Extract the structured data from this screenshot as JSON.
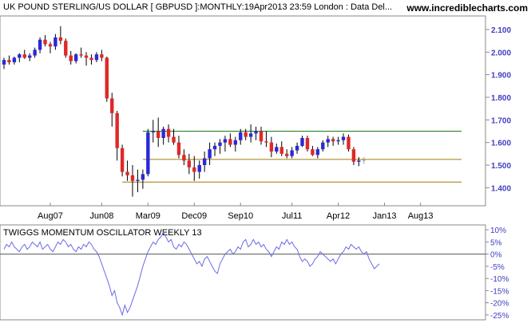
{
  "header": {
    "title": "UK POUND STERLING/US DOLLAR [ GBPUSD ]:MONTHLY:19Apr2013 23:59 London : Data Del...",
    "site": "www.incrediblecharts.com"
  },
  "colors": {
    "up": "#2a2ad6",
    "down": "#e02828",
    "last": "#9a9a9a",
    "resistance": "#1a7a1a",
    "support_line": "#a07a00",
    "oscillator": "#6a6ae8",
    "axis_text": "#4040c0",
    "frame": "#888888"
  },
  "chart_data": [
    {
      "type": "candlestick",
      "title": "UK POUND STERLING/US DOLLAR [ GBPUSD ]:MONTHLY:19Apr2013 23:59 London : Data Del...",
      "x_tick_labels": [
        "Aug07",
        "Jun08",
        "Mar09",
        "Dec09",
        "Sep10",
        "Jul11",
        "Apr12",
        "Jan13",
        "Aug13"
      ],
      "y_tick_labels": [
        "2.100",
        "2.000",
        "1.900",
        "1.800",
        "1.700",
        "1.600",
        "1.500",
        "1.400"
      ],
      "ylim": [
        1.32,
        2.16
      ],
      "start_month": "2006-11",
      "candles": [
        [
          1.945,
          1.975,
          1.925,
          1.965
        ],
        [
          1.965,
          1.985,
          1.945,
          1.955
        ],
        [
          1.955,
          1.98,
          1.945,
          1.975
        ],
        [
          1.975,
          1.995,
          1.955,
          1.99
        ],
        [
          1.99,
          2.01,
          1.97,
          1.975
        ],
        [
          1.975,
          1.995,
          1.96,
          1.985
        ],
        [
          1.985,
          2.02,
          1.975,
          2.01
        ],
        [
          2.01,
          2.065,
          1.995,
          2.055
        ],
        [
          2.055,
          2.075,
          2.025,
          2.035
        ],
        [
          2.035,
          2.045,
          1.995,
          2.025
        ],
        [
          2.025,
          2.08,
          2.01,
          2.065
        ],
        [
          2.065,
          2.115,
          2.035,
          2.05
        ],
        [
          2.05,
          2.06,
          1.975,
          1.985
        ],
        [
          1.985,
          2.005,
          1.945,
          1.96
        ],
        [
          1.96,
          1.995,
          1.95,
          1.99
        ],
        [
          1.99,
          2.02,
          1.975,
          1.985
        ],
        [
          1.985,
          2.0,
          1.94,
          1.975
        ],
        [
          1.975,
          1.99,
          1.945,
          1.965
        ],
        [
          1.965,
          2.0,
          1.955,
          1.99
        ],
        [
          1.99,
          2.01,
          1.96,
          1.975
        ],
        [
          1.975,
          1.98,
          1.78,
          1.795
        ],
        [
          1.795,
          1.82,
          1.67,
          1.73
        ],
        [
          1.73,
          1.74,
          1.52,
          1.575
        ],
        [
          1.575,
          1.59,
          1.45,
          1.47
        ],
        [
          1.47,
          1.52,
          1.43,
          1.455
        ],
        [
          1.455,
          1.5,
          1.36,
          1.43
        ],
        [
          1.43,
          1.48,
          1.38,
          1.435
        ],
        [
          1.435,
          1.48,
          1.395,
          1.46
        ],
        [
          1.46,
          1.66,
          1.45,
          1.645
        ],
        [
          1.645,
          1.7,
          1.6,
          1.65
        ],
        [
          1.65,
          1.71,
          1.58,
          1.62
        ],
        [
          1.62,
          1.67,
          1.59,
          1.66
        ],
        [
          1.66,
          1.68,
          1.6,
          1.625
        ],
        [
          1.625,
          1.66,
          1.59,
          1.6
        ],
        [
          1.6,
          1.63,
          1.53,
          1.545
        ],
        [
          1.545,
          1.57,
          1.5,
          1.52
        ],
        [
          1.52,
          1.55,
          1.46,
          1.49
        ],
        [
          1.49,
          1.54,
          1.43,
          1.47
        ],
        [
          1.47,
          1.52,
          1.44,
          1.5
        ],
        [
          1.5,
          1.56,
          1.47,
          1.53
        ],
        [
          1.53,
          1.6,
          1.5,
          1.57
        ],
        [
          1.57,
          1.6,
          1.54,
          1.585
        ],
        [
          1.585,
          1.615,
          1.55,
          1.6
        ],
        [
          1.6,
          1.63,
          1.56,
          1.615
        ],
        [
          1.615,
          1.64,
          1.58,
          1.59
        ],
        [
          1.59,
          1.625,
          1.56,
          1.61
        ],
        [
          1.61,
          1.66,
          1.59,
          1.645
        ],
        [
          1.645,
          1.66,
          1.61,
          1.625
        ],
        [
          1.625,
          1.68,
          1.6,
          1.64
        ],
        [
          1.64,
          1.67,
          1.61,
          1.65
        ],
        [
          1.65,
          1.67,
          1.59,
          1.605
        ],
        [
          1.605,
          1.65,
          1.58,
          1.6
        ],
        [
          1.6,
          1.625,
          1.535,
          1.56
        ],
        [
          1.56,
          1.595,
          1.55,
          1.58
        ],
        [
          1.58,
          1.605,
          1.54,
          1.55
        ],
        [
          1.55,
          1.57,
          1.53,
          1.54
        ],
        [
          1.54,
          1.58,
          1.53,
          1.565
        ],
        [
          1.565,
          1.6,
          1.55,
          1.585
        ],
        [
          1.585,
          1.63,
          1.58,
          1.62
        ],
        [
          1.62,
          1.63,
          1.56,
          1.57
        ],
        [
          1.57,
          1.585,
          1.54,
          1.545
        ],
        [
          1.545,
          1.58,
          1.53,
          1.57
        ],
        [
          1.57,
          1.61,
          1.56,
          1.6
        ],
        [
          1.6,
          1.63,
          1.58,
          1.615
        ],
        [
          1.615,
          1.625,
          1.585,
          1.605
        ],
        [
          1.605,
          1.625,
          1.59,
          1.61
        ],
        [
          1.61,
          1.64,
          1.59,
          1.625
        ],
        [
          1.625,
          1.635,
          1.56,
          1.57
        ],
        [
          1.57,
          1.58,
          1.5,
          1.515
        ],
        [
          1.515,
          1.535,
          1.495,
          1.52
        ],
        [
          1.52,
          1.535,
          1.505,
          1.525
        ]
      ],
      "horizontal_lines": [
        {
          "name": "resistance",
          "value": 1.65,
          "from_month_index": 27
        },
        {
          "name": "support",
          "value": 1.525,
          "from_month_index": 27
        },
        {
          "name": "low",
          "value": 1.425,
          "from_month_index": 23
        }
      ]
    },
    {
      "type": "line",
      "title": "TWIGGS MOMENTUM OSCILLATOR WEEKLY 13",
      "y_tick_labels": [
        "10%",
        "5%",
        "0%",
        "-5%",
        "-10%",
        "-15%",
        "-20%",
        "-25%"
      ],
      "ylim": [
        -27,
        12
      ],
      "zero_line": 0,
      "start_month": "2006-11",
      "points_per_month": 2,
      "values": [
        2,
        4,
        3,
        5,
        3,
        2,
        1,
        3,
        4,
        2,
        3,
        5,
        4,
        3,
        5,
        2,
        3,
        4,
        2,
        1,
        3,
        5,
        4,
        6,
        5,
        3,
        4,
        2,
        1,
        3,
        2,
        4,
        3,
        5,
        4,
        2,
        1,
        -1,
        -4,
        -7,
        -10,
        -13,
        -17,
        -15,
        -20,
        -22,
        -25,
        -21,
        -24,
        -22,
        -19,
        -16,
        -13,
        -9,
        -5,
        -2,
        1,
        3,
        5,
        4,
        6,
        7,
        9,
        7,
        5,
        6,
        3,
        2,
        4,
        3,
        5,
        4,
        2,
        0,
        -2,
        -4,
        -3,
        -5,
        -2,
        -1,
        -3,
        -5,
        -7,
        -8,
        -4,
        -2,
        0,
        1,
        2,
        0,
        1,
        3,
        2,
        5,
        6,
        3,
        4,
        6,
        4,
        5,
        3,
        4,
        2,
        1,
        -1,
        1,
        3,
        2,
        5,
        4,
        6,
        4,
        5,
        3,
        2,
        -1,
        -3,
        -2,
        -3,
        -5,
        -4,
        -2,
        -1,
        1,
        0,
        -1,
        -2,
        -3,
        -2,
        -4,
        -2,
        0,
        1,
        3,
        2,
        4,
        3,
        2,
        3,
        1,
        0,
        1,
        -2,
        -4,
        -6,
        -5,
        -4
      ]
    }
  ]
}
